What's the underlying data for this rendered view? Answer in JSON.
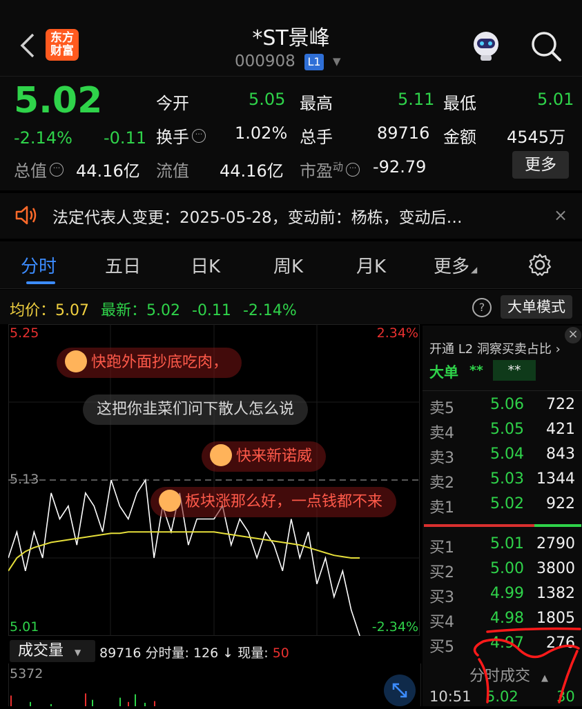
{
  "header": {
    "title": "*ST景峰",
    "code": "000908",
    "level_badge": "L1",
    "logo_line1": "东方",
    "logo_line2": "财富"
  },
  "quote": {
    "price": "5.02",
    "change_pct": "-2.14%",
    "change": "-0.11",
    "fields": {
      "open_label": "今开",
      "open": "5.05",
      "high_label": "最高",
      "high": "5.11",
      "low_label": "最低",
      "low": "5.01",
      "turnover_label": "换手",
      "turnover": "1.02%",
      "volume_label": "总手",
      "volume": "89716",
      "amount_label": "金额",
      "amount": "4545万",
      "mktcap_label": "总值",
      "mktcap": "44.16亿",
      "float_label": "流值",
      "float": "44.16亿",
      "pe_label": "市盈",
      "pe_sup": "动",
      "pe": "-92.79"
    },
    "more_button": "更多"
  },
  "notice": {
    "text": "法定代表人变更：2025-05-28，变动前：杨栋，变动后…",
    "close": "×"
  },
  "tabs": [
    {
      "label": "分时"
    },
    {
      "label": "五日"
    },
    {
      "label": "日K"
    },
    {
      "label": "周K"
    },
    {
      "label": "月K"
    },
    {
      "label": "更多"
    }
  ],
  "indicator": {
    "avg_label": "均价：",
    "avg": "5.07",
    "latest_label": "最新：",
    "latest": "5.02",
    "chg": "-0.11",
    "chg_pct": "-2.14%",
    "help": "?",
    "big_order_mode": "大单模式"
  },
  "chart": {
    "y_top": "5.25",
    "y_mid": "5.13",
    "y_bottom": "5.01",
    "pct_top": "2.34%",
    "pct_bottom": "-2.34%",
    "price_series": [
      5.07,
      5.09,
      5.06,
      5.09,
      5.07,
      5.12,
      5.1,
      5.11,
      5.08,
      5.12,
      5.11,
      5.09,
      5.13,
      5.11,
      5.1,
      5.12,
      5.13,
      5.07,
      5.11,
      5.09,
      5.12,
      5.08,
      5.1,
      5.1,
      5.1,
      5.11,
      5.08,
      5.1,
      5.09,
      5.07,
      5.09,
      5.08,
      5.06,
      5.1,
      5.07,
      5.09,
      5.05,
      5.07,
      5.04,
      5.06,
      5.03,
      5.01
    ],
    "avg_series": [
      5.06,
      5.07,
      5.075,
      5.078,
      5.08,
      5.082,
      5.083,
      5.084,
      5.085,
      5.086,
      5.087,
      5.088,
      5.089,
      5.089,
      5.09,
      5.09,
      5.09,
      5.09,
      5.09,
      5.09,
      5.09,
      5.09,
      5.09,
      5.09,
      5.09,
      5.089,
      5.088,
      5.087,
      5.086,
      5.085,
      5.084,
      5.083,
      5.082,
      5.081,
      5.08,
      5.078,
      5.076,
      5.074,
      5.072,
      5.071,
      5.07,
      5.07
    ]
  },
  "danmu": [
    {
      "text": "快跑外面抄底吃肉，",
      "style": "red"
    },
    {
      "text": "这把你韭菜们问下散人怎么说",
      "style": "grey"
    },
    {
      "text": "快来新诺威",
      "style": "red"
    },
    {
      "text": "板块涨那么好，一点钱都不来",
      "style": "red"
    }
  ],
  "orderbook": {
    "promo": "开通 L2 洞察买卖占比 ›",
    "big_label": "大单",
    "big_val1": "**",
    "big_val2": "**",
    "asks": [
      {
        "label": "卖5",
        "price": "5.06",
        "qty": "722"
      },
      {
        "label": "卖4",
        "price": "5.05",
        "qty": "421"
      },
      {
        "label": "卖3",
        "price": "5.04",
        "qty": "843"
      },
      {
        "label": "卖2",
        "price": "5.03",
        "qty": "1344"
      },
      {
        "label": "卖1",
        "price": "5.02",
        "qty": "922"
      }
    ],
    "bids": [
      {
        "label": "买1",
        "price": "5.01",
        "qty": "2790"
      },
      {
        "label": "买2",
        "price": "5.00",
        "qty": "3800"
      },
      {
        "label": "买3",
        "price": "4.99",
        "qty": "1382"
      },
      {
        "label": "买4",
        "price": "4.98",
        "qty": "1805"
      },
      {
        "label": "买5",
        "price": "4.97",
        "qty": "276"
      }
    ],
    "trades_header": "分时成交",
    "trade_time": "10:51",
    "trade_price": "5.02",
    "trade_qty": "30"
  },
  "volume": {
    "select": "成交量",
    "total": "89716",
    "minute_label": "分时量:",
    "minute": "126",
    "arrow": "↓",
    "now_label": "现量:",
    "now": "50",
    "max": "5372",
    "bars": [
      0.25,
      0.1,
      0.05,
      0.3,
      0.15,
      0.2,
      0.1,
      0.28,
      0.08,
      0.12
    ]
  }
}
